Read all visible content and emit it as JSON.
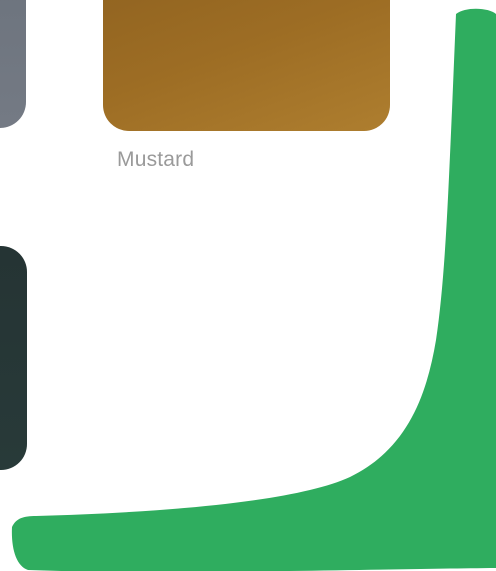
{
  "swatches": [
    {
      "id": "gray",
      "color": "#6f7680"
    },
    {
      "id": "mustard",
      "color": "#a0702a",
      "label": "Mustard"
    },
    {
      "id": "dark",
      "color": "#263737"
    }
  ],
  "annotation": {
    "color": "#2fad5f"
  }
}
